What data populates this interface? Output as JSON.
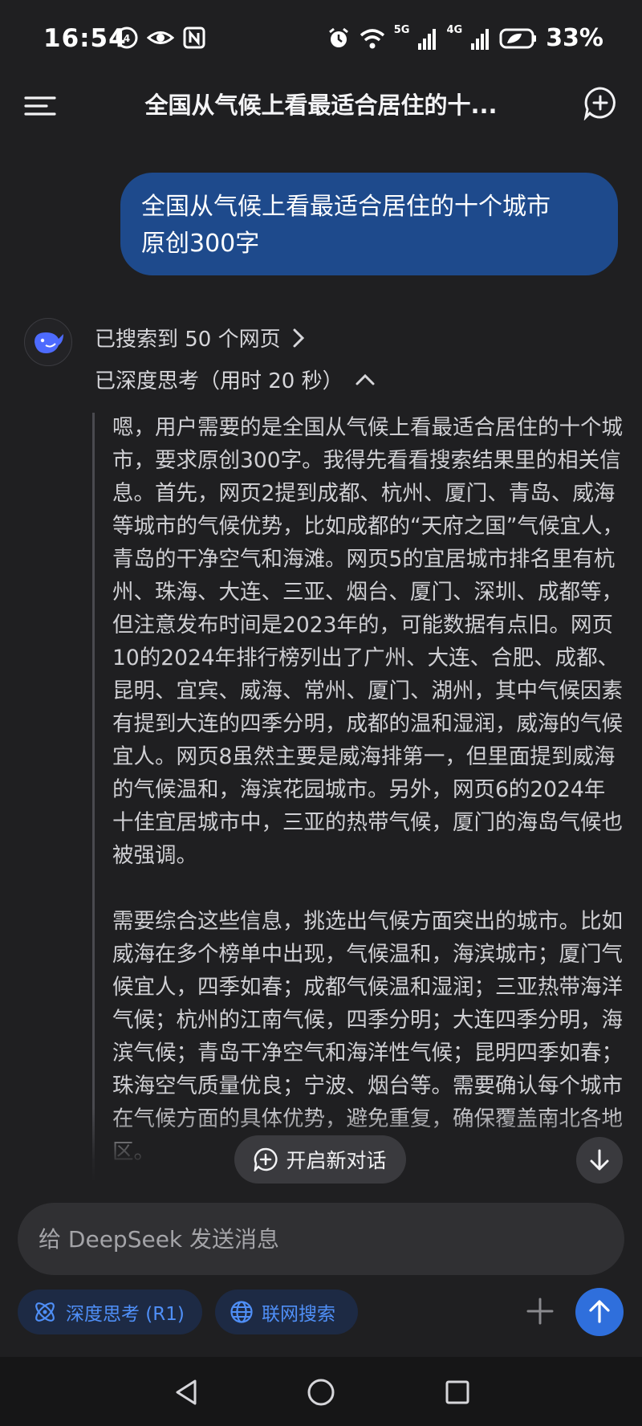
{
  "status_bar": {
    "time": "16:54",
    "battery": "33%",
    "net_5g": "5G",
    "net_4g": "4G"
  },
  "header": {
    "title": "全国从气候上看最适合居住的十..."
  },
  "user_message": {
    "text": "全国从气候上看最适合居住的十个城市\n原创300字"
  },
  "assistant": {
    "search_result": "已搜索到 50 个网页",
    "thinking_status": "已深度思考（用时 20 秒）",
    "thought_paragraphs": [
      "嗯，用户需要的是全国从气候上看最适合居住的十个城市，要求原创300字。我得先看看搜索结果里的相关信息。首先，网页2提到成都、杭州、厦门、青岛、威海等城市的气候优势，比如成都的“天府之国”气候宜人，青岛的干净空气和海滩。网页5的宜居城市排名里有杭州、珠海、大连、三亚、烟台、厦门、深圳、成都等，但注意发布时间是2023年的，可能数据有点旧。网页10的2024年排行榜列出了广州、大连、合肥、成都、昆明、宜宾、威海、常州、厦门、湖州，其中气候因素有提到大连的四季分明，成都的温和湿润，威海的气候宜人。网页8虽然主要是威海排第一，但里面提到威海的气候温和，海滨花园城市。另外，网页6的2024年十佳宜居城市中，三亚的热带气候，厦门的海岛气候也被强调。",
      "需要综合这些信息，挑选出气候方面突出的城市。比如威海在多个榜单中出现，气候温和，海滨城市；厦门气候宜人，四季如春；成都气候温和湿润；三亚热带海洋气候；杭州的江南气候，四季分明；大连四季分明，海滨气候；青岛干净空气和海洋性气候；昆明四季如春；珠海空气质量优良；宁波、烟台等。需要确认每个城市在气候方面的具体优势，避免重复，确保覆盖南北各地区。"
    ]
  },
  "floating": {
    "new_chat_label": "开启新对话"
  },
  "composer": {
    "placeholder": "给 DeepSeek 发送消息",
    "deep_think_label": "深度思考 (R1)",
    "web_search_label": "联网搜索"
  },
  "colors": {
    "background": "#1f1f21",
    "user_bubble": "#1e4a8c",
    "accent_blue": "#4f8ff7",
    "send_button": "#2f6fdc",
    "chip_bg": "#1d2a44"
  },
  "icons": {
    "menu": "menu-icon",
    "new_chat": "new-chat-icon",
    "avatar": "deepseek-whale-icon",
    "chevron_right": "chevron-right-icon",
    "chevron_up": "chevron-up-icon",
    "arrow_down": "arrow-down-icon",
    "atom": "atom-icon",
    "globe": "globe-icon",
    "plus": "plus-icon",
    "arrow_up": "arrow-up-icon"
  }
}
